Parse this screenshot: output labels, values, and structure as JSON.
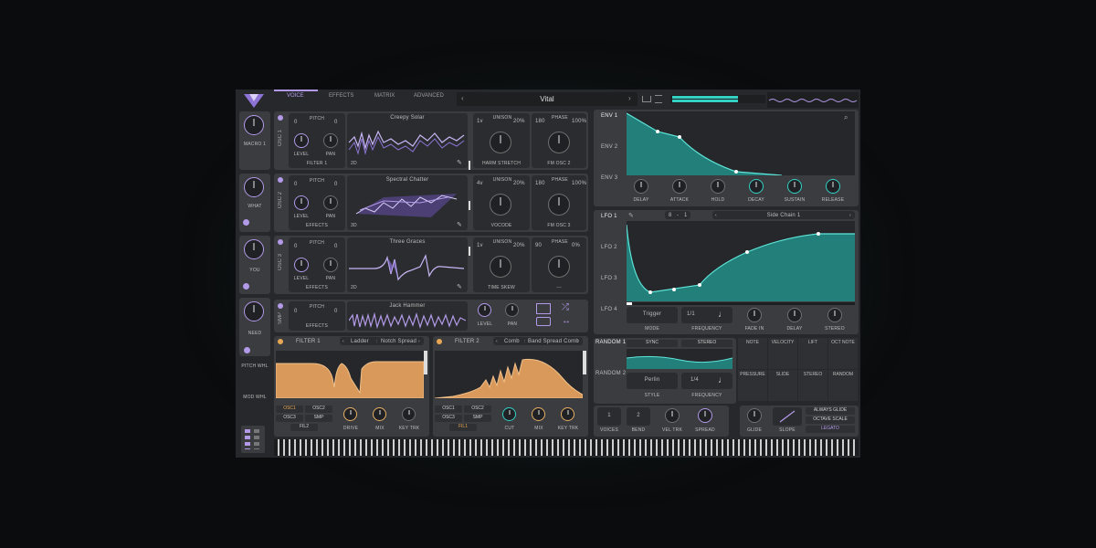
{
  "app": {
    "tabs": [
      "VOICE",
      "EFFECTS",
      "MATRIX",
      "ADVANCED"
    ],
    "active_tab": "VOICE",
    "preset_name": "Vital",
    "accent": "#b39ae8",
    "teal": "#33d1c4",
    "orange": "#e7a754"
  },
  "macros": [
    {
      "label": "MACRO 1"
    },
    {
      "label": "WHAT"
    },
    {
      "label": "YOU"
    },
    {
      "label": "NEED"
    }
  ],
  "wheels": {
    "pitch": "PITCH WHL",
    "mod": "MOD WHL"
  },
  "oscillators": [
    {
      "name": "OSC 1",
      "pitch_left": "0",
      "pitch_label": "PITCH",
      "pitch_right": "0",
      "level": "LEVEL",
      "pan": "PAN",
      "dest": "FILTER 1",
      "wave_name": "Creepy Solar",
      "dim": "2D",
      "unison_voices": "1v",
      "unison_label": "UNISON",
      "unison_pct": "20%",
      "phase_left": "180",
      "phase_label": "PHASE",
      "phase_pct": "100%",
      "mod_a": "HARM STRETCH",
      "mod_b": "FM OSC 2"
    },
    {
      "name": "OSC 2",
      "pitch_left": "0",
      "pitch_label": "PITCH",
      "pitch_right": "0",
      "level": "LEVEL",
      "pan": "PAN",
      "dest": "EFFECTS",
      "wave_name": "Spectral Chatter",
      "dim": "3D",
      "unison_voices": "4v",
      "unison_label": "UNISON",
      "unison_pct": "20%",
      "phase_left": "180",
      "phase_label": "PHASE",
      "phase_pct": "100%",
      "mod_a": "VOCODE",
      "mod_b": "FM OSC 3"
    },
    {
      "name": "OSC 3",
      "pitch_left": "0",
      "pitch_label": "PITCH",
      "pitch_right": "0",
      "level": "LEVEL",
      "pan": "PAN",
      "dest": "EFFECTS",
      "wave_name": "Three Graces",
      "dim": "2D",
      "unison_voices": "1v",
      "unison_label": "UNISON",
      "unison_pct": "20%",
      "phase_left": "90",
      "phase_label": "PHASE",
      "phase_pct": "0%",
      "mod_a": "TIME SKEW",
      "mod_b": "---"
    }
  ],
  "sampler": {
    "name": "SMP",
    "pitch_left": "0",
    "pitch_label": "PITCH",
    "pitch_right": "0",
    "dest": "EFFECTS",
    "sample_name": "Jack Hammer",
    "level": "LEVEL",
    "pan": "PAN"
  },
  "filters": [
    {
      "name": "FILTER 1",
      "model": "Ladder",
      "style": "Notch Spread",
      "inputs": [
        "OSC1",
        "OSC2",
        "OSC3",
        "SMP"
      ],
      "fil_btn": "FIL2",
      "knobs": [
        "DRIVE",
        "MIX",
        "KEY TRK"
      ]
    },
    {
      "name": "FILTER 2",
      "model": "Comb",
      "style": "Band Spread Comb",
      "inputs": [
        "OSC1",
        "OSC2",
        "OSC3",
        "SMP"
      ],
      "fil_btn": "FIL1",
      "knobs": [
        "CUT",
        "MIX",
        "KEY TRK"
      ]
    }
  ],
  "envelopes": {
    "tabs": [
      "ENV 1",
      "ENV 2",
      "ENV 3"
    ],
    "knobs": [
      "DELAY",
      "ATTACK",
      "HOLD",
      "DECAY",
      "SUSTAIN",
      "RELEASE"
    ]
  },
  "lfo": {
    "tabs": [
      "LFO 1",
      "LFO 2",
      "LFO 3",
      "LFO 4"
    ],
    "grid_x": "8",
    "grid_sep": "-",
    "grid_y": "1",
    "preset": "Side Chain 1",
    "mode_value": "Trigger",
    "mode_label": "MODE",
    "freq_value": "1/1",
    "freq_label": "FREQUENCY",
    "knobs": [
      "FADE IN",
      "DELAY",
      "STEREO"
    ]
  },
  "random": {
    "tabs": [
      "RANDOM 1",
      "RANDOM 2"
    ],
    "sync": "SYNC",
    "stereo": "STEREO",
    "style_value": "Perlin",
    "style_label": "STYLE",
    "freq_value": "1/4",
    "freq_label": "FREQUENCY"
  },
  "mod_sources": [
    "NOTE",
    "VELOCITY",
    "LIFT",
    "OCT NOTE",
    "PRESSURE",
    "SLIDE",
    "STEREO",
    "RANDOM"
  ],
  "voice": {
    "voices": "1",
    "voices_label": "VOICES",
    "bend": "2",
    "bend_label": "BEND",
    "vel_trk": "VEL TRK",
    "spread": "SPREAD",
    "glide": "GLIDE",
    "slope": "SLOPE",
    "always_glide": "ALWAYS GLIDE",
    "octave_scale": "OCTAVE SCALE",
    "legato": "LEGATO"
  }
}
